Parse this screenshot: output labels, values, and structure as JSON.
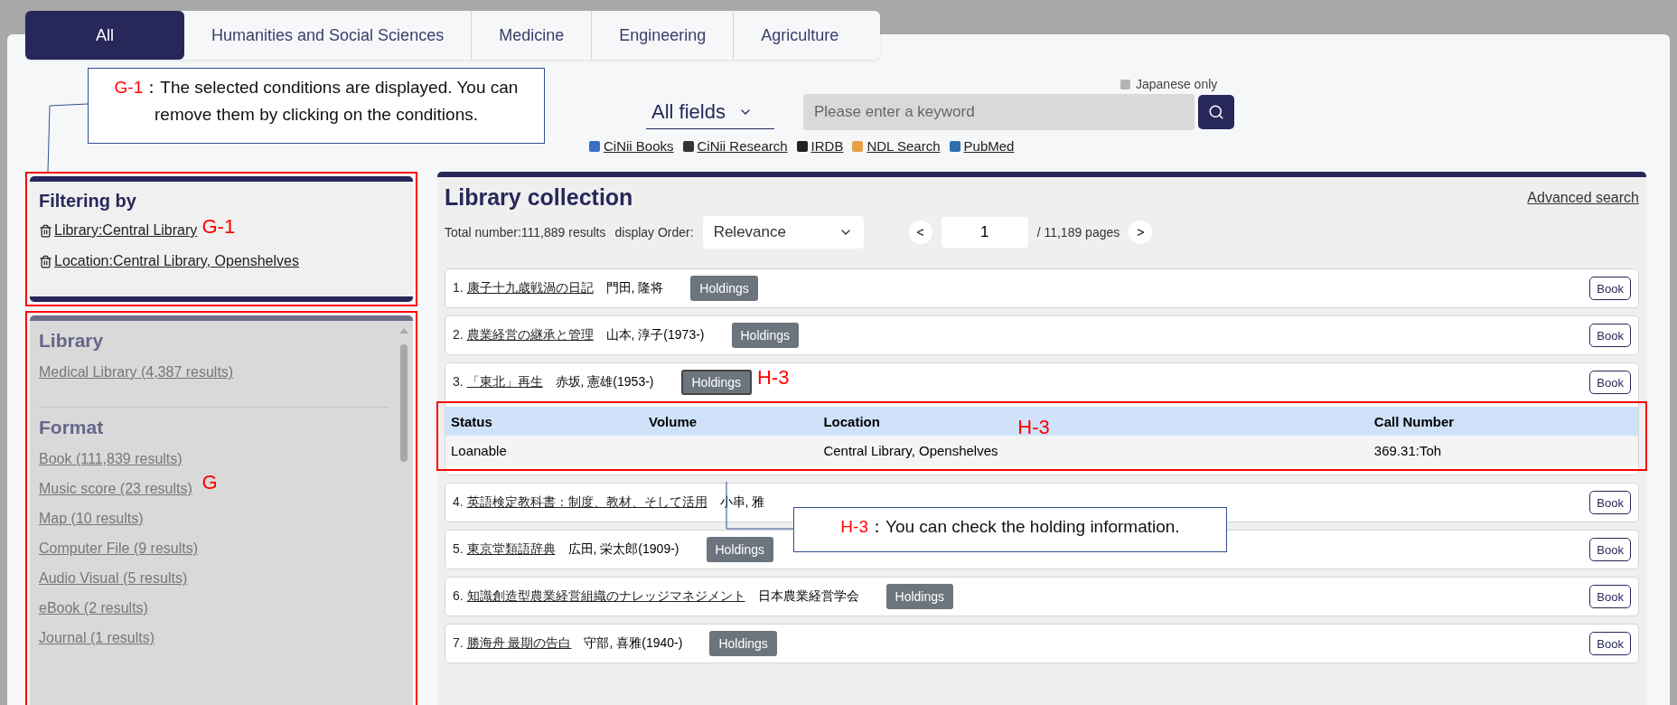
{
  "tabs": [
    {
      "label": "All",
      "selected": true
    },
    {
      "label": "Humanities and Social Sciences",
      "selected": false
    },
    {
      "label": "Medicine",
      "selected": false
    },
    {
      "label": "Engineering",
      "selected": false
    },
    {
      "label": "Agriculture",
      "selected": false
    }
  ],
  "search": {
    "japanese_only": {
      "label": "Japanese only",
      "checked": false
    },
    "field": "All fields",
    "placeholder": "Please enter a keyword",
    "links": [
      {
        "label": "CiNii Books",
        "color": "#3a6fc4"
      },
      {
        "label": "CiNii Research",
        "color": "#333333"
      },
      {
        "label": "IRDB",
        "color": "#222222"
      },
      {
        "label": "NDL Search",
        "color": "#e8a04a"
      },
      {
        "label": "PubMed",
        "color": "#2f6fb0"
      }
    ]
  },
  "filter_panel": {
    "title": "Filtering by",
    "annotation": "G-1",
    "conditions": [
      "Library:Central Library",
      "Location:Central Library, Openshelves"
    ]
  },
  "facet_panel": {
    "annotation": "G",
    "groups": [
      {
        "title": "Library",
        "items": [
          "Medical Library (4,387 results)"
        ]
      },
      {
        "title": "Format",
        "items": [
          "Book (111,839 results)",
          "Music score (23 results)",
          "Map (10 results)",
          "Computer File (9 results)",
          "Audio Visual (5 results)",
          "eBook (2 results)",
          "Journal (1 results)"
        ]
      }
    ]
  },
  "results": {
    "title": "Library collection",
    "advanced": "Advanced search",
    "total": "Total number:111,889 results",
    "order_label": "display Order:",
    "order": "Relevance",
    "prev": "<",
    "page": "1",
    "pages": "/ 11,189 pages",
    "next": ">",
    "rows": [
      {
        "number": "1.",
        "title": "康子十九歳戦渦の日記",
        "author": "門田, 隆将",
        "holdings": "Holdings",
        "type": "Book"
      },
      {
        "number": "2.",
        "title": "農業経営の継承と管理",
        "author": "山本, 淳子(1973-)",
        "holdings": "Holdings",
        "type": "Book"
      },
      {
        "number": "3.",
        "title": "「東北」再生",
        "author": "赤坂, 憲雄(1953-)",
        "holdings": "Holdings",
        "holdings_annotation": "H-3",
        "type": "Book",
        "table": {
          "annotation": "H-3",
          "columns": [
            "Status",
            "Volume",
            "Location",
            "Call Number"
          ],
          "rows": [
            [
              "Loanable",
              "",
              "Central Library, Openshelves",
              "369.31:Toh"
            ]
          ]
        }
      },
      {
        "number": "4.",
        "title": "英語検定教科書：制度、教材、そして活用",
        "author": "小串, 雅",
        "type": "Book"
      },
      {
        "number": "5.",
        "title": "東京堂類語辞典",
        "author": "広田, 栄太郎(1909-)",
        "holdings": "Holdings",
        "type": "Book"
      },
      {
        "number": "6.",
        "title": "知識創造型農業経営組織のナレッジマネジメント",
        "author": "日本農業経営学会",
        "holdings": "Holdings",
        "type": "Book"
      },
      {
        "number": "7.",
        "title": "勝海舟 最期の告白",
        "author": "守部, 喜雅(1940-)",
        "holdings": "Holdings",
        "type": "Book"
      }
    ]
  },
  "callouts": [
    {
      "tag": "G-1",
      "text": "：The selected conditions are displayed. You can remove them by clicking on the conditions."
    },
    {
      "tag": "H-3",
      "text": "：You can check the holding information."
    }
  ]
}
